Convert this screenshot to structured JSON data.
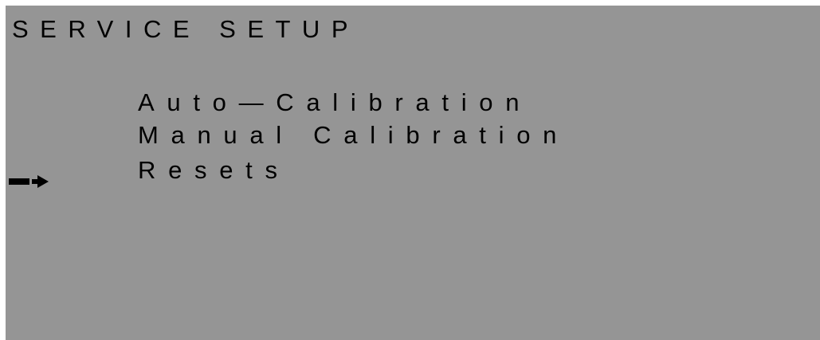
{
  "screen": {
    "title": "SERVICE SETUP",
    "background_color": "#959595",
    "text_color": "#000000"
  },
  "menu": {
    "items": [
      {
        "label": "Auto—Calibration",
        "selected": false
      },
      {
        "label": "Manual Calibration",
        "selected": false
      },
      {
        "label": "Resets",
        "selected": true
      }
    ],
    "cursor_icon": "arrow-right-icon"
  }
}
